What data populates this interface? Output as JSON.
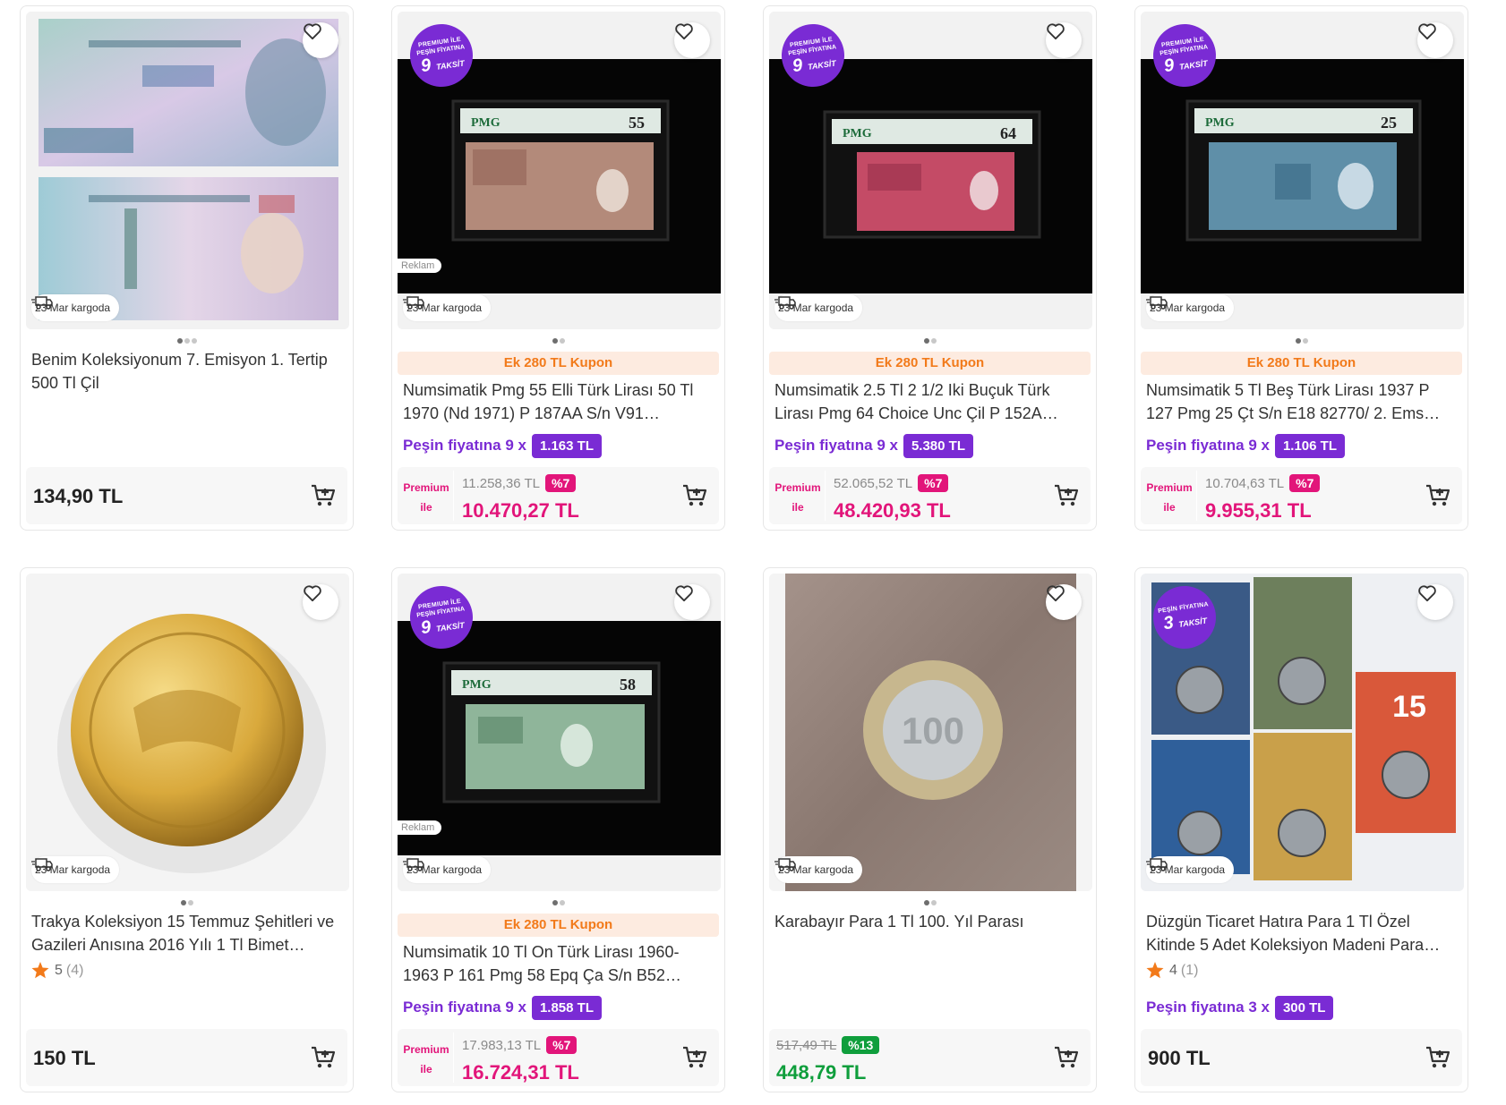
{
  "cargo_text": "23 Mar kargoda",
  "reklam_text": "Reklam",
  "premium_badge": {
    "top": "PREMIUM İLE",
    "mid": "PEŞİN FİYATINA",
    "num9": "9",
    "num3": "3",
    "taksit": "TAKSİT"
  },
  "premium_label": "Premium ile",
  "colors": {
    "accent_orange": "#f27a1a",
    "premium_purple": "#7a2bd4",
    "discount_pink": "#e2157a",
    "discount_green": "#0f9e3c"
  },
  "products": [
    {
      "title": "Benim Koleksiyonum 7. Emisyon 1. Tertip 500 Tl Çil",
      "price": "134,90 TL",
      "image": "banknote-500-lira"
    },
    {
      "title": "Numsimatik Pmg 55 Elli Türk Lirası 50 Tl 1970 (Nd 1971) P 187AA S/n V91…",
      "coupon": "Ek 280 TL Kupon",
      "installment_text": "Peşin fiyatına 9 x",
      "installment_amount": "1.163 TL",
      "old_price": "11.258,36 TL",
      "discount": "%7",
      "new_price": "10.470,27 TL",
      "pmg_grade": "55",
      "image": "pmg-banknote-brown"
    },
    {
      "title": "Numsimatik 2.5 Tl 2 1/2 Iki Buçuk Türk Lirası Pmg 64 Choice Unc Çil P 152A…",
      "coupon": "Ek 280 TL Kupon",
      "installment_text": "Peşin fiyatına 9 x",
      "installment_amount": "5.380 TL",
      "old_price": "52.065,52 TL",
      "discount": "%7",
      "new_price": "48.420,93 TL",
      "pmg_grade": "64",
      "image": "pmg-banknote-red"
    },
    {
      "title": "Numsimatik 5 Tl Beş Türk Lirası 1937 P 127 Pmg 25 Çt S/n E18 82770/ 2. Ems…",
      "coupon": "Ek 280 TL Kupon",
      "installment_text": "Peşin fiyatına 9 x",
      "installment_amount": "1.106 TL",
      "old_price": "10.704,63 TL",
      "discount": "%7",
      "new_price": "9.955,31 TL",
      "pmg_grade": "25",
      "image": "pmg-banknote-blue"
    },
    {
      "title": "Trakya Koleksiyon 15 Temmuz Şehitleri ve Gazileri Anısına 2016 Yılı 1 Tl Bimet…",
      "rating": "5",
      "rating_count": "(4)",
      "price": "150 TL",
      "image": "gold-coin"
    },
    {
      "title": "Numsimatik 10 Tl On Türk Lirası 1960-1963 P 161 Pmg 58 Epq Ça S/n B52…",
      "coupon": "Ek 280 TL Kupon",
      "installment_text": "Peşin fiyatına 9 x",
      "installment_amount": "1.858 TL",
      "old_price": "17.983,13 TL",
      "discount": "%7",
      "new_price": "16.724,31 TL",
      "pmg_grade": "58",
      "image": "pmg-banknote-green"
    },
    {
      "title": "Karabayır Para 1 Tl 100. Yıl Parası",
      "old_price": "517,49 TL",
      "discount": "%13",
      "new_price": "448,79 TL",
      "image": "bimetal-coin-on-wood"
    },
    {
      "title": "Düzgün Ticaret Hatıra Para 1 Tl Özel Kitinde 5 Adet Koleksiyon Madeni Para…",
      "rating": "4",
      "rating_count": "(1)",
      "installment_text": "Peşin fiyatına 3 x",
      "installment_amount": "300 TL",
      "price": "900 TL",
      "image": "coin-collection-cards"
    }
  ]
}
